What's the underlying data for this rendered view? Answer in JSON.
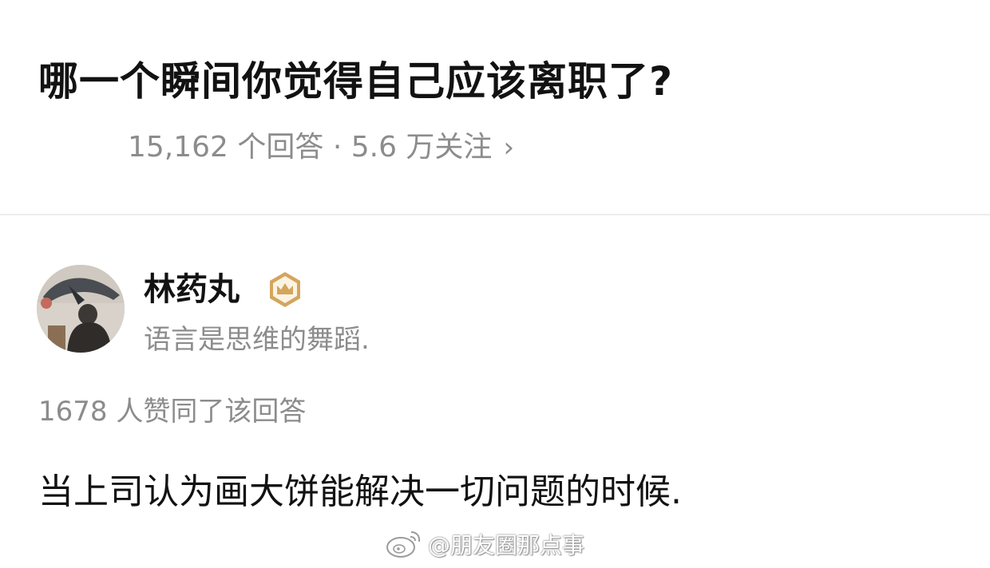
{
  "question": {
    "title": "哪一个瞬间你觉得自己应该离职了?",
    "meta": "15,162 个回答 · 5.6 万关注",
    "meta_icon": "chevron-right-icon"
  },
  "author": {
    "name": "林药丸",
    "badge_icon": "crown-badge-icon",
    "badge_color": "#D4A55C",
    "bio": "语言是思维的舞蹈."
  },
  "answer": {
    "vote_text": "1678 人赞同了该回答",
    "content": "当上司认为画大饼能解决一切问题的时候."
  },
  "watermark": {
    "text": "@朋友圈那点事",
    "icon": "weibo-logo-icon"
  }
}
